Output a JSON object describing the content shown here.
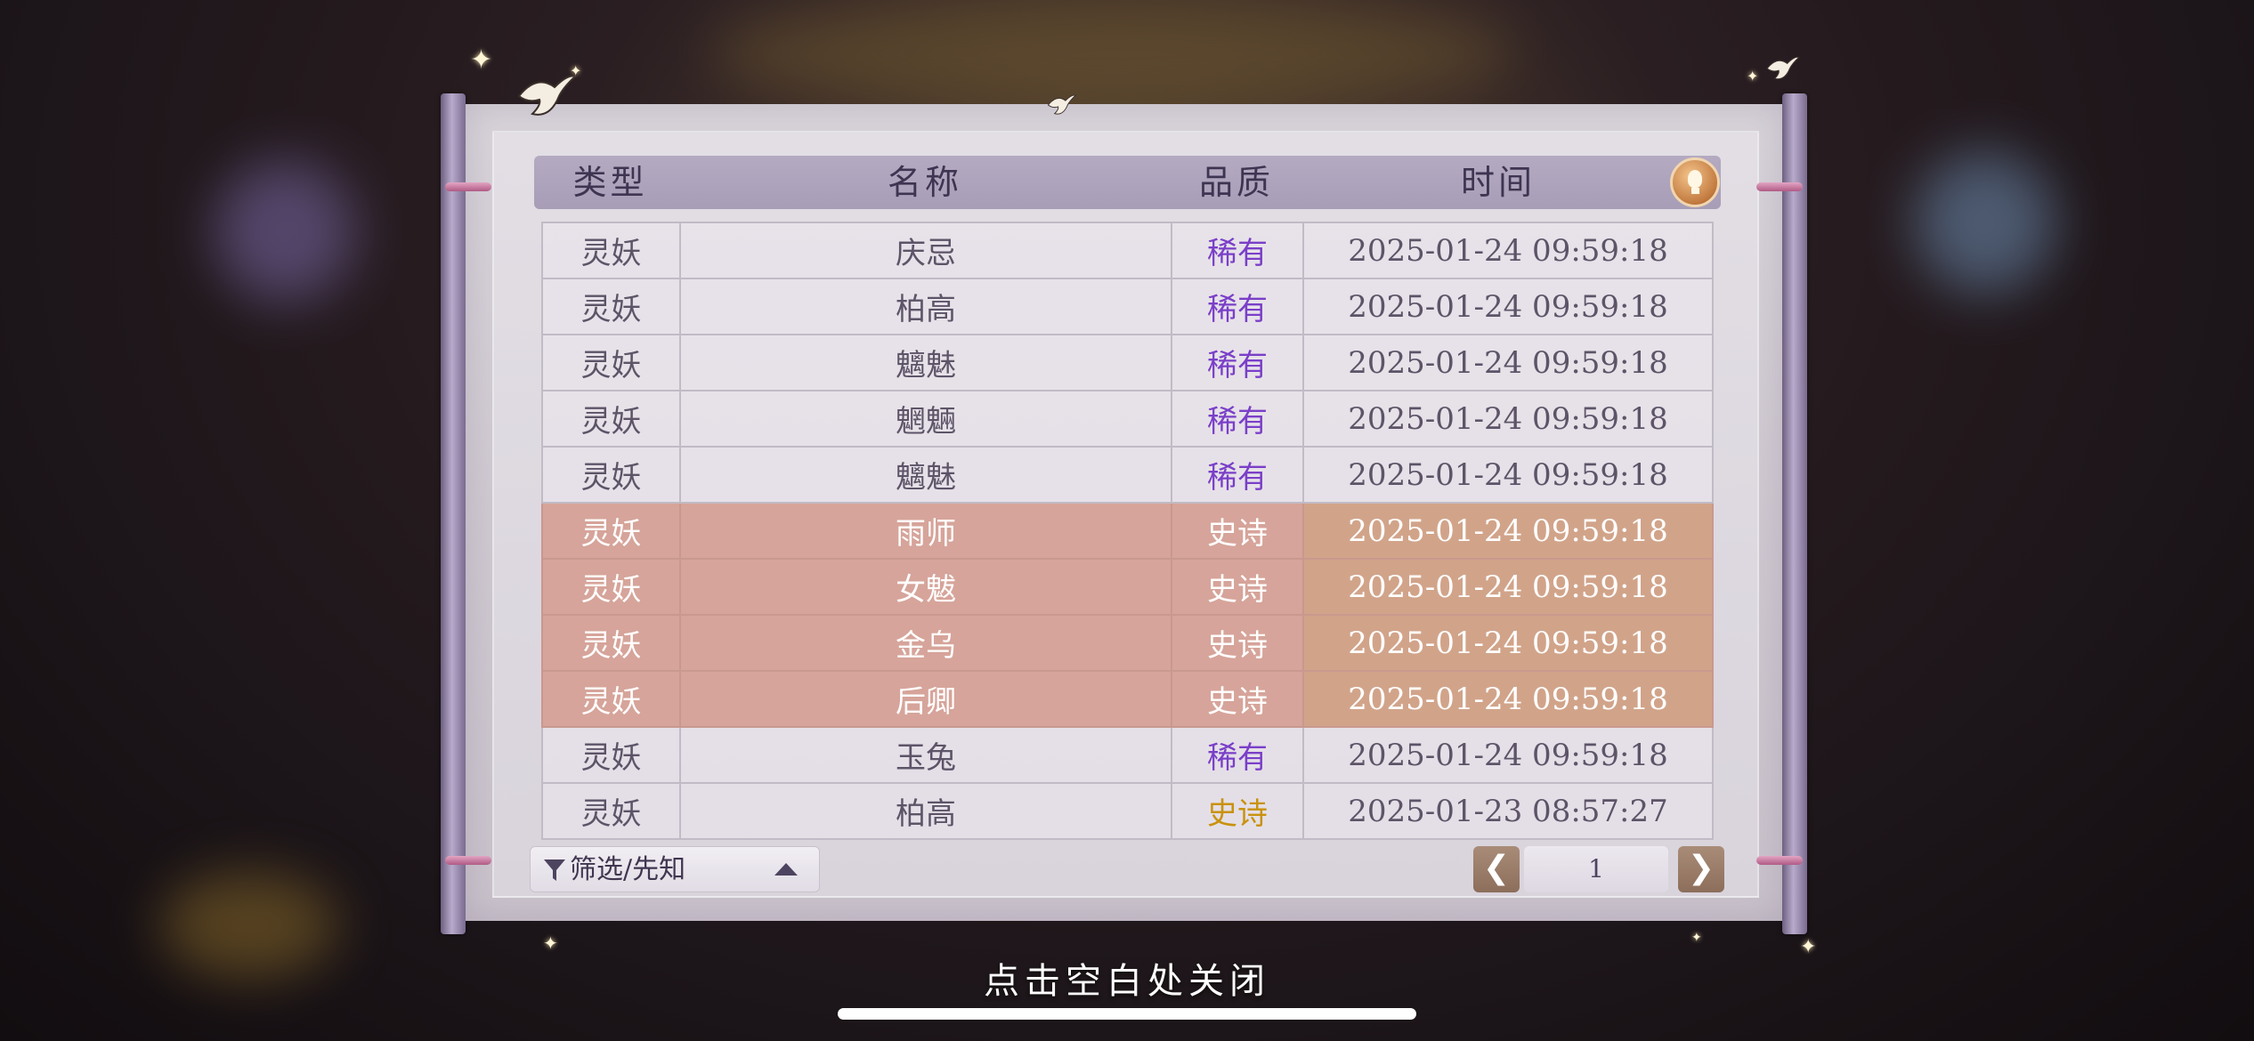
{
  "table": {
    "headers": [
      "类型",
      "名称",
      "品质",
      "时间"
    ],
    "rows": [
      {
        "type": "灵妖",
        "name": "庆忌",
        "quality": "稀有",
        "time": "2025-01-24  09:59:18",
        "style": "normal",
        "quality_color": "#7a3fc8"
      },
      {
        "type": "灵妖",
        "name": "柏高",
        "quality": "稀有",
        "time": "2025-01-24  09:59:18",
        "style": "normal",
        "quality_color": "#7a3fc8"
      },
      {
        "type": "灵妖",
        "name": "魑魅",
        "quality": "稀有",
        "time": "2025-01-24  09:59:18",
        "style": "normal",
        "quality_color": "#7a3fc8"
      },
      {
        "type": "灵妖",
        "name": "魍魎",
        "quality": "稀有",
        "time": "2025-01-24  09:59:18",
        "style": "normal",
        "quality_color": "#7a3fc8"
      },
      {
        "type": "灵妖",
        "name": "魑魅",
        "quality": "稀有",
        "time": "2025-01-24  09:59:18",
        "style": "normal",
        "quality_color": "#7a3fc8"
      },
      {
        "type": "灵妖",
        "name": "雨师",
        "quality": "史诗",
        "time": "2025-01-24  09:59:18",
        "style": "epic",
        "quality_color": "#ffffff"
      },
      {
        "type": "灵妖",
        "name": "女魃",
        "quality": "史诗",
        "time": "2025-01-24  09:59:18",
        "style": "epic",
        "quality_color": "#ffffff"
      },
      {
        "type": "灵妖",
        "name": "金乌",
        "quality": "史诗",
        "time": "2025-01-24  09:59:18",
        "style": "epic",
        "quality_color": "#ffffff"
      },
      {
        "type": "灵妖",
        "name": "后卿",
        "quality": "史诗",
        "time": "2025-01-24  09:59:18",
        "style": "epic",
        "quality_color": "#ffffff"
      },
      {
        "type": "灵妖",
        "name": "玉兔",
        "quality": "稀有",
        "time": "2025-01-24  09:59:18",
        "style": "normal",
        "quality_color": "#7a3fc8"
      },
      {
        "type": "灵妖",
        "name": "柏高",
        "quality": "史诗",
        "time": "2025-01-23  08:57:27",
        "style": "normal",
        "quality_color": "#c9920e"
      }
    ]
  },
  "filter": {
    "label": "筛选/先知",
    "icon": "filter-icon"
  },
  "pagination": {
    "prev": "❮",
    "page": "1",
    "next": "❯"
  },
  "hint_icon": "lightbulb-icon",
  "close_hint": "点击空白处关闭",
  "colors": {
    "rare": "#7a3fc8",
    "epic_row": "#d6a49a",
    "epic_gold": "#c9920e",
    "header": "#a89db7"
  }
}
